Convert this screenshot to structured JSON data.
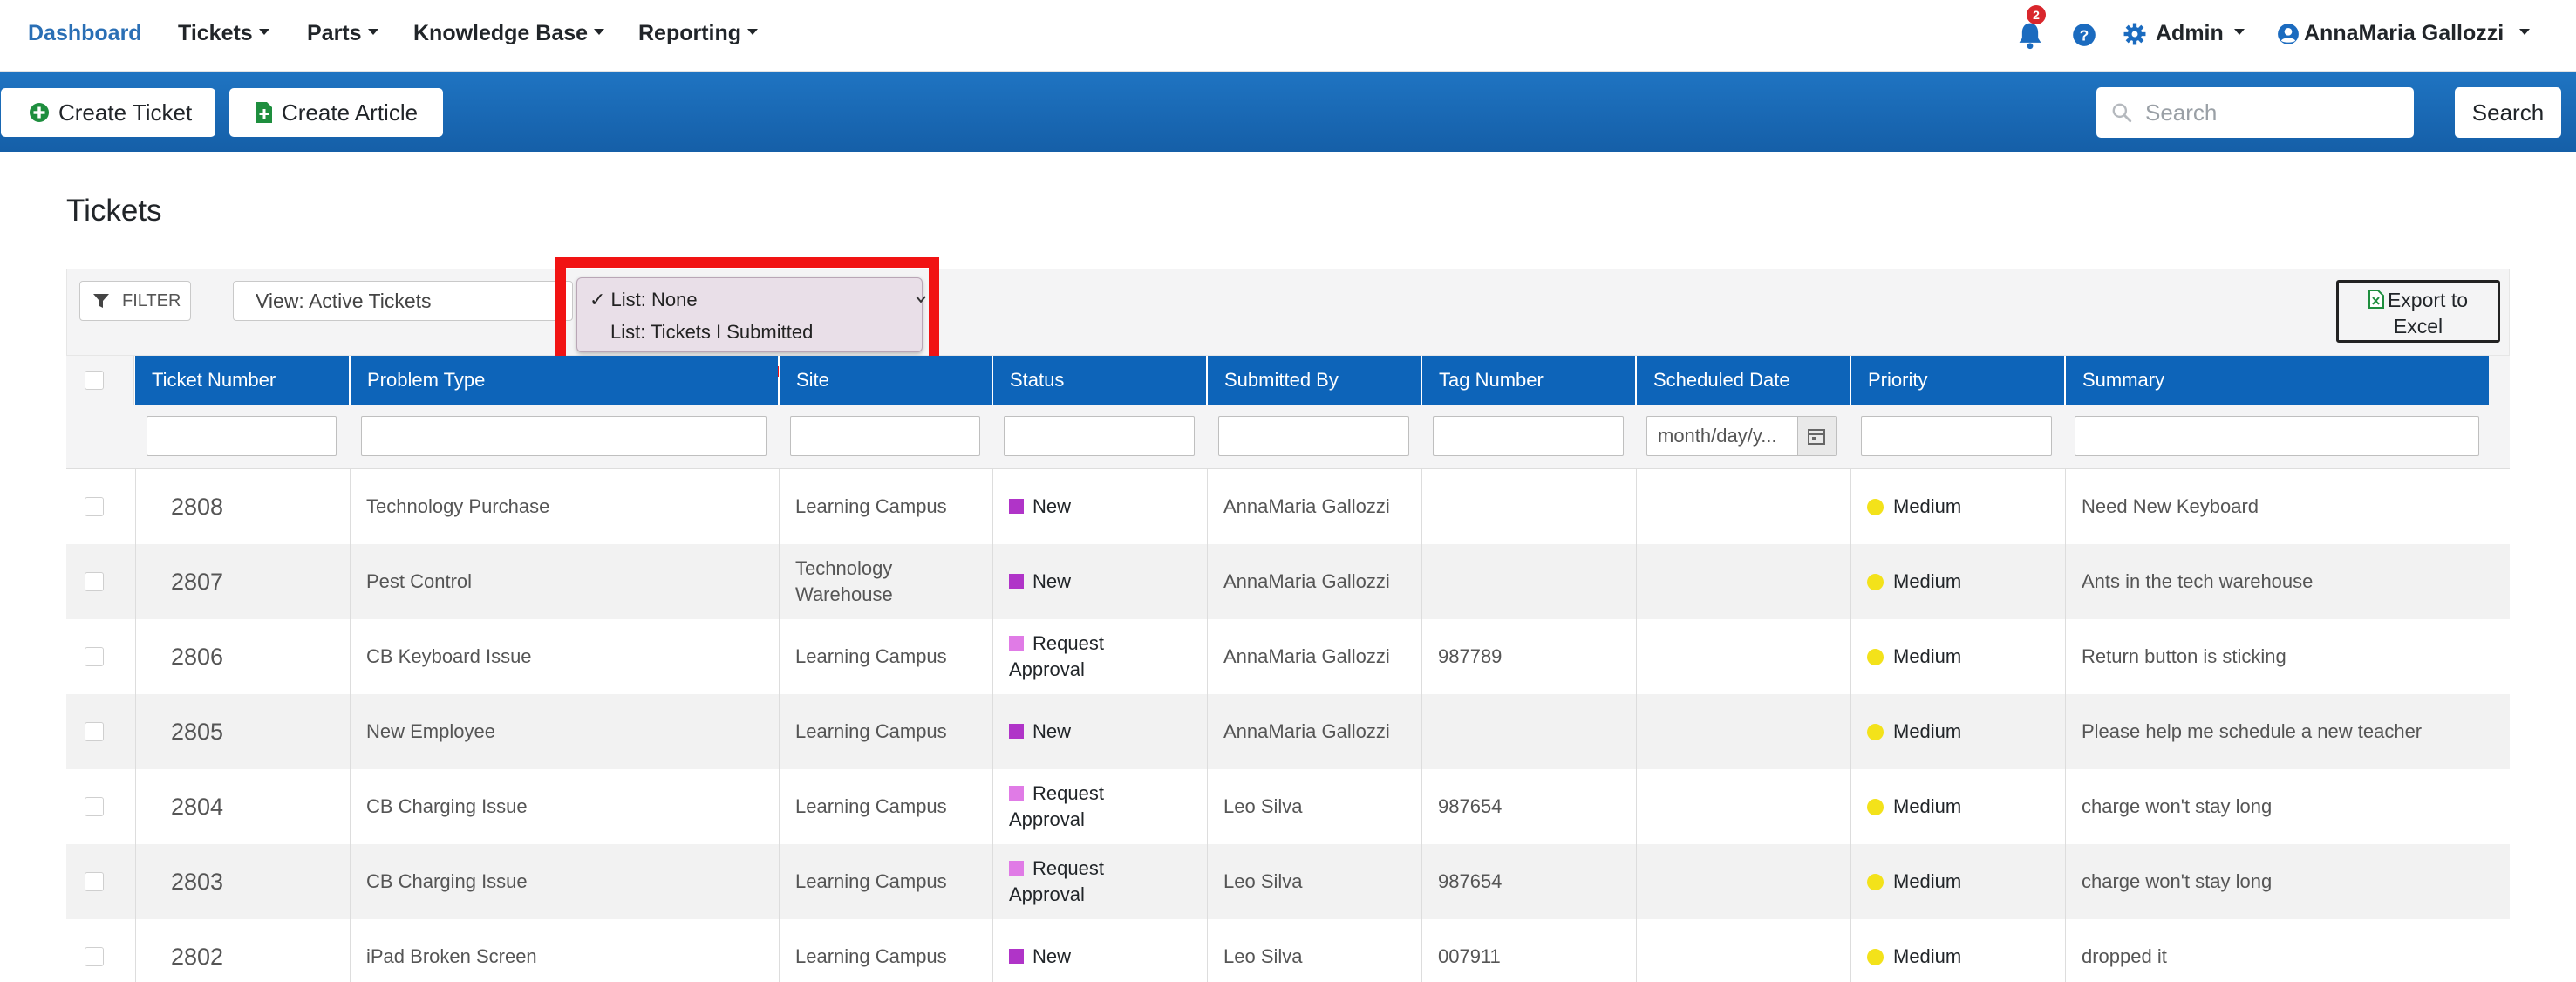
{
  "nav": {
    "brand": "Dashboard",
    "items": [
      "Tickets",
      "Parts",
      "Knowledge Base",
      "Reporting"
    ],
    "notification_count": "2",
    "admin_label": "Admin",
    "user_name": "AnnaMaria Gallozzi"
  },
  "actions": {
    "create_ticket": "Create Ticket",
    "create_article": "Create Article",
    "search_placeholder": "Search",
    "search_button": "Search"
  },
  "page_title": "Tickets",
  "toolbar": {
    "filter_label": "FILTER",
    "view_select": "View: Active Tickets",
    "list_options": [
      {
        "label": "List: None",
        "checked": true
      },
      {
        "label": "List: Tickets I Submitted",
        "checked": false
      }
    ],
    "export_label_line1": "Export to",
    "export_label_line2": "Excel"
  },
  "table": {
    "columns": [
      "Ticket Number",
      "Problem Type",
      "Site",
      "Status",
      "Submitted By",
      "Tag Number",
      "Scheduled Date",
      "Priority",
      "Summary"
    ],
    "date_placeholder": "month/day/y...",
    "status_colors": {
      "New": "#b034c8",
      "Request Approval": "#e07be6"
    },
    "priority_color": "#f3e21a",
    "rows": [
      {
        "ticket": "2808",
        "problem": "Technology Purchase",
        "site": "Learning Campus",
        "status_l1": "New",
        "status_l2": "",
        "status_key": "New",
        "submitted_by": "AnnaMaria Gallozzi",
        "tag": "",
        "scheduled": "",
        "priority": "Medium",
        "summary": "Need New Keyboard"
      },
      {
        "ticket": "2807",
        "problem": "Pest Control",
        "site": "Technology Warehouse",
        "status_l1": "New",
        "status_l2": "",
        "status_key": "New",
        "submitted_by": "AnnaMaria Gallozzi",
        "tag": "",
        "scheduled": "",
        "priority": "Medium",
        "summary": "Ants in the tech warehouse"
      },
      {
        "ticket": "2806",
        "problem": "CB Keyboard Issue",
        "site": "Learning Campus",
        "status_l1": "Request",
        "status_l2": "Approval",
        "status_key": "Request Approval",
        "submitted_by": "AnnaMaria Gallozzi",
        "tag": "987789",
        "scheduled": "",
        "priority": "Medium",
        "summary": "Return button is sticking"
      },
      {
        "ticket": "2805",
        "problem": "New Employee",
        "site": "Learning Campus",
        "status_l1": "New",
        "status_l2": "",
        "status_key": "New",
        "submitted_by": "AnnaMaria Gallozzi",
        "tag": "",
        "scheduled": "",
        "priority": "Medium",
        "summary": "Please help me schedule a new teacher"
      },
      {
        "ticket": "2804",
        "problem": "CB Charging Issue",
        "site": "Learning Campus",
        "status_l1": "Request",
        "status_l2": "Approval",
        "status_key": "Request Approval",
        "submitted_by": "Leo Silva",
        "tag": "987654",
        "scheduled": "",
        "priority": "Medium",
        "summary": "charge won't stay long"
      },
      {
        "ticket": "2803",
        "problem": "CB Charging Issue",
        "site": "Learning Campus",
        "status_l1": "Request",
        "status_l2": "Approval",
        "status_key": "Request Approval",
        "submitted_by": "Leo Silva",
        "tag": "987654",
        "scheduled": "",
        "priority": "Medium",
        "summary": "charge won't stay long"
      },
      {
        "ticket": "2802",
        "problem": "iPad Broken Screen",
        "site": "Learning Campus",
        "status_l1": "New",
        "status_l2": "",
        "status_key": "New",
        "submitted_by": "Leo Silva",
        "tag": "007911",
        "scheduled": "",
        "priority": "Medium",
        "summary": "dropped it"
      }
    ]
  }
}
